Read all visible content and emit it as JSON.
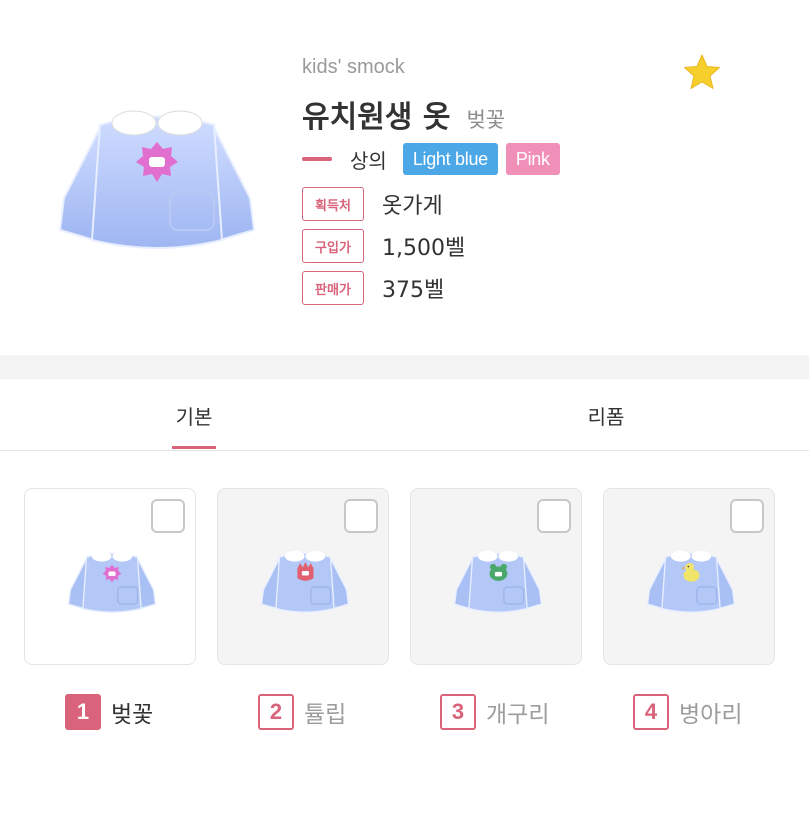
{
  "item": {
    "subtitle": "kids' smock",
    "title": "유치원생 옷",
    "variant_name": "벚꽃",
    "favorite_icon": "star-icon",
    "favorite_color": "#f7cf2c"
  },
  "category": {
    "label": "상의",
    "colors": [
      {
        "label": "Light blue",
        "bg": "#4ca7e6"
      },
      {
        "label": "Pink",
        "bg": "#f08fb8"
      }
    ]
  },
  "info": [
    {
      "tag": "획득처",
      "value": "옷가게"
    },
    {
      "tag": "구입가",
      "value": "1,500벨"
    },
    {
      "tag": "판매가",
      "value": "375벨"
    }
  ],
  "tabs": [
    {
      "label": "기본",
      "active": true
    },
    {
      "label": "리폼",
      "active": false
    }
  ],
  "variants": [
    {
      "number": "1",
      "label": "벚꽃",
      "selected": true,
      "badge_color": "#e06fd0"
    },
    {
      "number": "2",
      "label": "튤립",
      "selected": false,
      "badge_color": "#e0606f"
    },
    {
      "number": "3",
      "label": "개구리",
      "selected": false,
      "badge_color": "#4aa86a"
    },
    {
      "number": "4",
      "label": "병아리",
      "selected": false,
      "badge_color": "#f1e46a"
    }
  ],
  "accent_color": "#d9637a"
}
